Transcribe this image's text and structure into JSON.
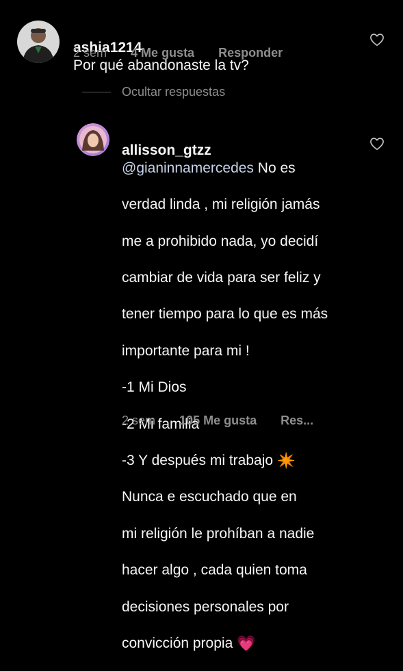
{
  "comments": [
    {
      "username": "ashia1214",
      "text": "Por qué abandonaste la tv?",
      "time": "2 sem",
      "likes": "4 Me gusta",
      "reply_label": "Responder"
    }
  ],
  "replies_toggle": "Ocultar respuestas",
  "reply": {
    "username": "allisson_gtzz",
    "mention": "@gianinnamercedes",
    "text_lines": [
      " No es",
      "verdad linda , mi religión jamás",
      "me a prohibido nada, yo decidí",
      "cambiar de vida para ser feliz y",
      "tener tiempo para lo que es más",
      "importante para mi !",
      "-1 Mi Dios",
      "-2 Mi familia",
      "-3 Y después mi trabajo ",
      "Nunca e escuchado que en",
      "mi religión le prohíban a nadie",
      "hacer algo , cada quien toma",
      "decisiones personales por",
      "convicción propia "
    ],
    "emoji_sparkle": "✴️",
    "emoji_heart": "💗",
    "time": "2 sem",
    "likes": "105 Me gusta",
    "reply_label": "Res..."
  },
  "colors": {
    "background": "#000000",
    "text": "#f5f5f5",
    "meta": "#8e8e8e",
    "mention": "#c7d3e8"
  }
}
